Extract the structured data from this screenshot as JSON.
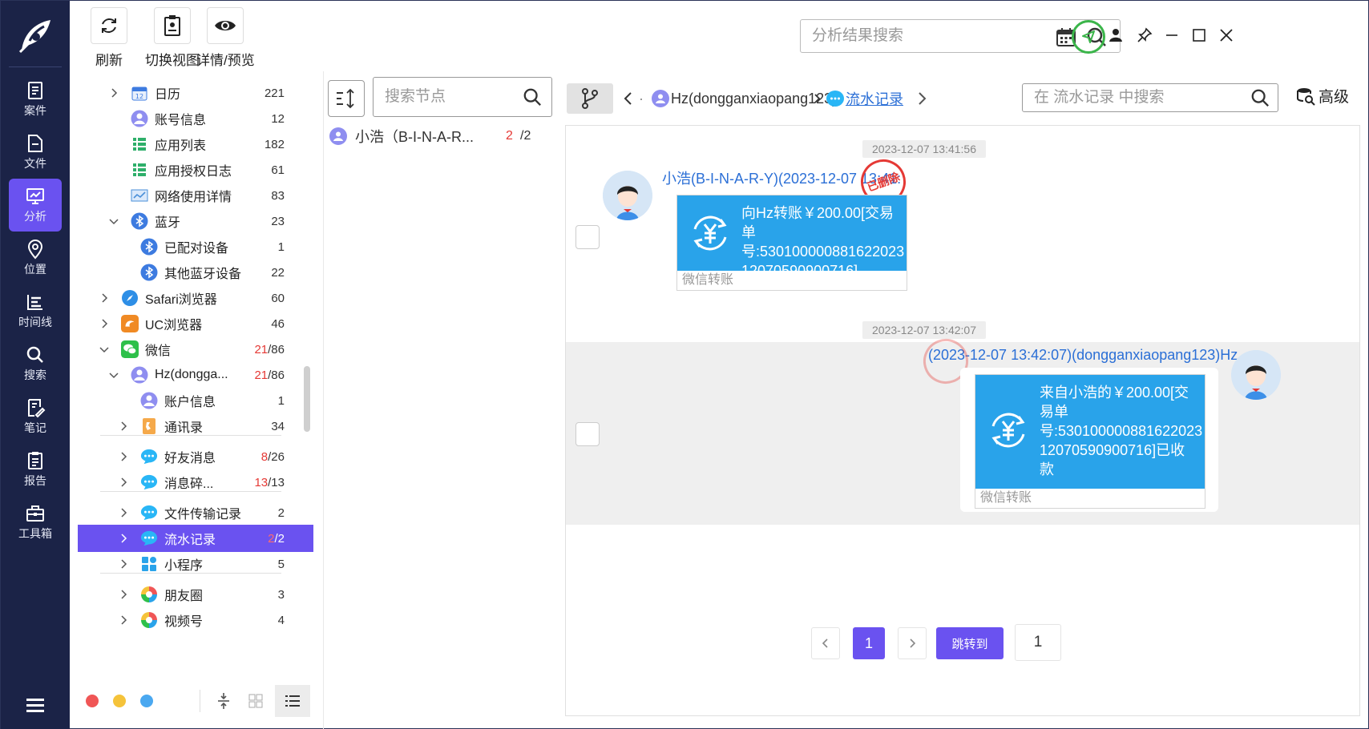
{
  "toolbar": {
    "refresh_label": "刷新",
    "switch_view_label": "切换视图",
    "details_label": "详情/预览",
    "search_placeholder": "分析结果搜索"
  },
  "nav": [
    {
      "label": "案件",
      "icon": "case-icon",
      "active": false
    },
    {
      "label": "文件",
      "icon": "file-icon",
      "active": false
    },
    {
      "label": "分析",
      "icon": "analysis-icon",
      "active": true
    },
    {
      "label": "位置",
      "icon": "location-icon",
      "active": false
    },
    {
      "label": "时间线",
      "icon": "timeline-icon",
      "active": false
    },
    {
      "label": "搜索",
      "icon": "search-icon",
      "active": false
    },
    {
      "label": "笔记",
      "icon": "note-icon",
      "active": false
    },
    {
      "label": "报告",
      "icon": "report-icon",
      "active": false
    },
    {
      "label": "工具箱",
      "icon": "toolbox-icon",
      "active": false
    }
  ],
  "tree": [
    {
      "label": "日历",
      "count": "221",
      "icon": "calendar-icon",
      "color": "#3d7be0",
      "indent": 1,
      "chev": "right"
    },
    {
      "label": "账号信息",
      "count": "12",
      "icon": "account-icon",
      "color": "#8f8ef0",
      "indent": 1,
      "chev": ""
    },
    {
      "label": "应用列表",
      "count": "182",
      "icon": "app-list-icon",
      "color": "#2eaf6a",
      "indent": 1,
      "chev": ""
    },
    {
      "label": "应用授权日志",
      "count": "61",
      "icon": "app-auth-icon",
      "color": "#2eaf6a",
      "indent": 1,
      "chev": ""
    },
    {
      "label": "网络使用详情",
      "count": "83",
      "icon": "network-icon",
      "color": "#4a8fd8",
      "indent": 1,
      "chev": ""
    },
    {
      "label": "蓝牙",
      "count": "23",
      "icon": "bluetooth-icon",
      "color": "#3d7be0",
      "indent": 1,
      "chev": "down"
    },
    {
      "label": "已配对设备",
      "count": "1",
      "icon": "bluetooth-icon",
      "color": "#3d7be0",
      "indent": 2,
      "chev": ""
    },
    {
      "label": "其他蓝牙设备",
      "count": "22",
      "icon": "bluetooth-icon",
      "color": "#3d7be0",
      "indent": 2,
      "chev": ""
    },
    {
      "label": "Safari浏览器",
      "count": "60",
      "icon": "safari-icon",
      "color": "#2d8ee6",
      "indent": 0,
      "chev": "right"
    },
    {
      "label": "UC浏览器",
      "count": "46",
      "icon": "uc-browser-icon",
      "color": "#f08a24",
      "indent": 0,
      "chev": "right"
    },
    {
      "label": "微信",
      "count_red": "21",
      "count_total": "/86",
      "icon": "wechat-icon",
      "color": "#2ec04a",
      "indent": 0,
      "chev": "down"
    },
    {
      "label": "Hz(dongga...",
      "count_red": "21",
      "count_total": "/86",
      "icon": "account-icon",
      "color": "#8f8ef0",
      "indent": 1,
      "chev": "down"
    },
    {
      "label": "账户信息",
      "count": "1",
      "icon": "account-icon",
      "color": "#8f8ef0",
      "indent": 2,
      "chev": ""
    },
    {
      "label": "通讯录",
      "count": "34",
      "icon": "contacts-icon",
      "color": "#f5a94a",
      "indent": 2,
      "chev": "right"
    },
    {
      "label": "好友消息",
      "count_red": "8",
      "count_total": "/26",
      "icon": "chat-icon",
      "color": "#29b6f6",
      "indent": 2,
      "chev": "right"
    },
    {
      "label": "消息碎...",
      "count_red": "13",
      "count_total": "/13",
      "icon": "chat-icon",
      "color": "#29b6f6",
      "indent": 2,
      "chev": "right"
    },
    {
      "label": "文件传输记录",
      "count": "2",
      "icon": "chat-icon",
      "color": "#29b6f6",
      "indent": 2,
      "chev": "right"
    },
    {
      "label": "流水记录",
      "count_red": "2",
      "count_total": "/2",
      "icon": "chat-icon",
      "color": "#29b6f6",
      "indent": 2,
      "chev": "right",
      "selected": true
    },
    {
      "label": "小程序",
      "count": "5",
      "icon": "mini-program-icon",
      "color": "#29a3ea",
      "indent": 2,
      "chev": "right"
    },
    {
      "label": "朋友圈",
      "count": "3",
      "icon": "moments-icon",
      "color": "#e04f7a",
      "indent": 2,
      "chev": "right"
    },
    {
      "label": "视频号",
      "count": "4",
      "icon": "channels-icon",
      "color": "#e04f7a",
      "indent": 2,
      "chev": "right"
    }
  ],
  "node_panel": {
    "search_placeholder": "搜索节点",
    "node_label": "小浩（B-I-N-A-R...",
    "node_count_red": "2",
    "node_count_total": "/2"
  },
  "breadcrumb": {
    "dot": "·",
    "account": "Hz(dongganxiaopang123)",
    "current": "流水记录"
  },
  "right_search": {
    "placeholder": "在 流水记录 中搜索",
    "advanced_label": "高级"
  },
  "messages": [
    {
      "timestamp": "2023-12-07 13:41:56",
      "sender": "小浩(B-I-N-A-R-Y)(2023-12-07 13:41:",
      "card_text": "向Hz转账￥200.00[交易单号:530100000881622023 12070590900716]",
      "card_footer": "微信转账",
      "stamp": "已删除",
      "direction": "in"
    },
    {
      "timestamp": "2023-12-07 13:42:07",
      "sender": "(2023-12-07 13:42:07)(dongganxiaopang123)Hz",
      "card_text": "来自小浩的￥200.00[交易单号:530100000881622023 12070590900716]已收款",
      "card_footer": "微信转账",
      "direction": "out"
    }
  ],
  "pagination": {
    "current_page": "1",
    "jump_label": "跳转到",
    "jump_value": "1"
  },
  "colors": {
    "nav_bg": "#1b2347",
    "accent": "#6a52f0",
    "card_blue": "#29a3ea",
    "link": "#2b6fd6",
    "count_red": "#e53935"
  }
}
